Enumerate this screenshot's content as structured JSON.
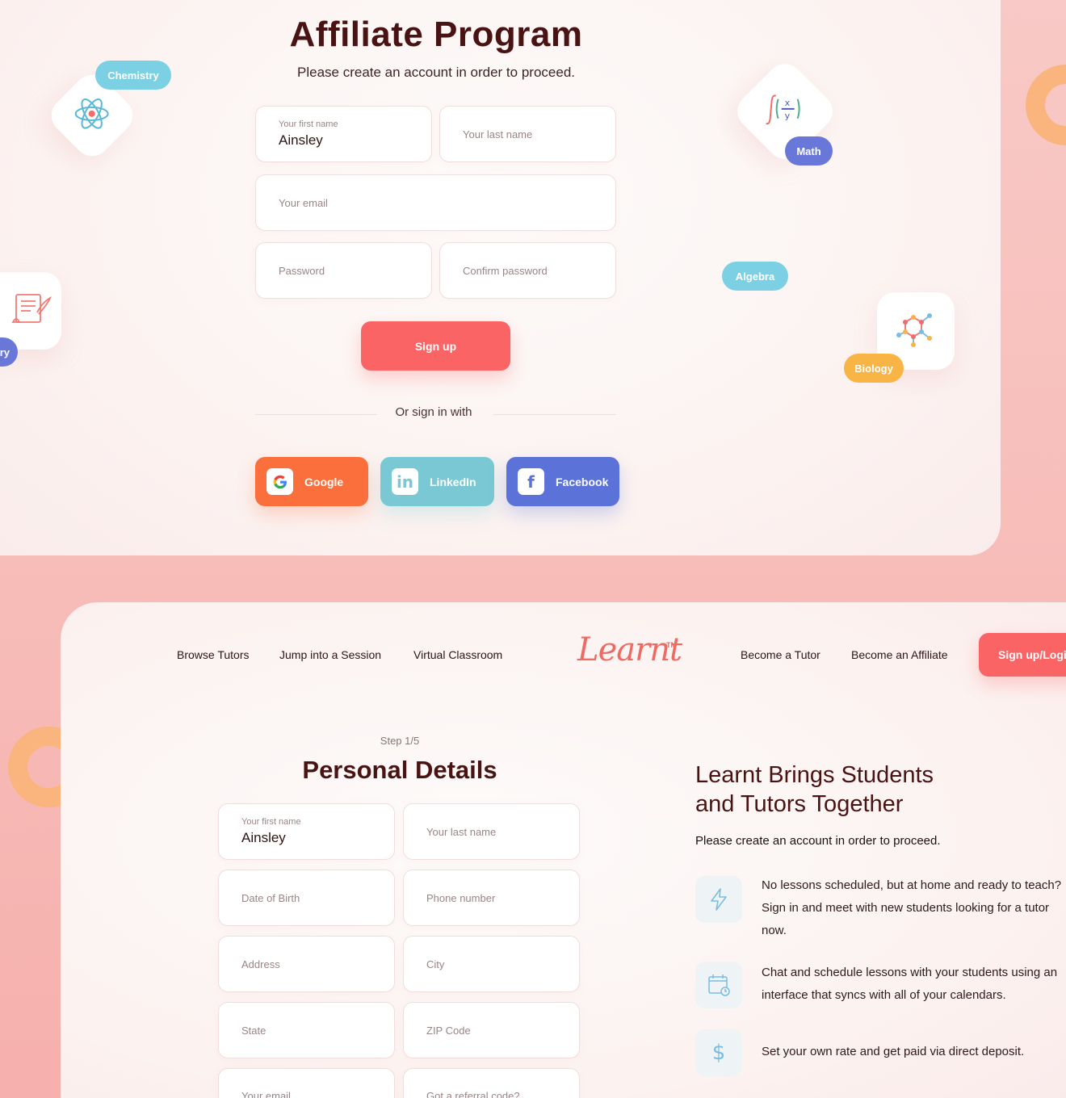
{
  "affiliate": {
    "title": "Affiliate Program",
    "subtitle": "Please create an account in order to proceed.",
    "first_name_label": "Your first name",
    "first_name_value": "Ainsley",
    "last_name_placeholder": "Your last name",
    "email_placeholder": "Your email",
    "password_placeholder": "Password",
    "confirm_placeholder": "Confirm password",
    "signup_label": "Sign up",
    "or_text": "Or sign in with",
    "social": {
      "google": "Google",
      "linkedin": "LinkedIn",
      "facebook": "Facebook"
    }
  },
  "subjects": {
    "chemistry": "Chemistry",
    "math": "Math",
    "algebra": "Algebra",
    "biology": "Biology",
    "history_fragment": "ry"
  },
  "nav": {
    "browse": "Browse Tutors",
    "jump": "Jump into a Session",
    "virtual": "Virtual Classroom",
    "logo": "Learnt",
    "logo_tm": "TM",
    "become_tutor": "Become a Tutor",
    "become_affiliate": "Become an Affiliate",
    "signup_login": "Sign up/Login"
  },
  "personal": {
    "step": "Step 1/5",
    "title": "Personal Details",
    "first_name_label": "Your first name",
    "first_name_value": "Ainsley",
    "last_name_placeholder": "Your last name",
    "dob_placeholder": "Date of Birth",
    "phone_placeholder": "Phone number",
    "address_placeholder": "Address",
    "city_placeholder": "City",
    "state_placeholder": "State",
    "zip_placeholder": "ZIP Code",
    "email_placeholder": "Your email",
    "referral_placeholder": "Got a referral code?"
  },
  "learnt": {
    "heading_line1": "Learnt Brings Students",
    "heading_line2": "and Tutors Together",
    "subheading": "Please create an account in order to proceed.",
    "features": [
      {
        "icon": "lightning-icon",
        "text": "No lessons scheduled, but at home and ready to teach? Sign in and meet with new students looking for a tutor now."
      },
      {
        "icon": "calendar-icon",
        "text": "Chat and schedule lessons with your students using an interface that syncs with all of your calendars."
      },
      {
        "icon": "dollar-icon",
        "text": "Set your own rate and get paid via direct deposit."
      }
    ]
  },
  "colors": {
    "primary": "#fb6464",
    "google": "#fb6f3d",
    "linkedin": "#79c8d3",
    "facebook": "#5b73d9",
    "heading": "#4a1313",
    "chemistry_pill": "#7cd0e4",
    "math_pill": "#6978d8",
    "algebra_pill": "#7cd0e4",
    "biology_pill": "#f8b545",
    "ring": "#f9b57d"
  }
}
